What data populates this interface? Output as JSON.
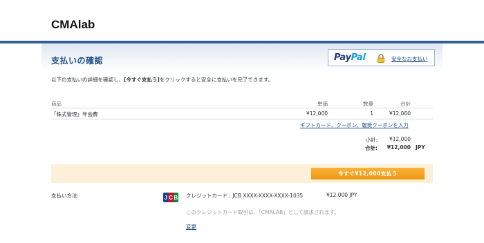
{
  "merchant": {
    "name": "CMAlab"
  },
  "header": {
    "title": "支払いの確認"
  },
  "paypal": {
    "logo_pay": "Pay",
    "logo_pal": "Pal",
    "secure_link": "安全なお支払い"
  },
  "intro": {
    "before": "以下の支払いの詳細を確認し、",
    "action": "[今すぐ支払う]",
    "after": "をクリックすると安全に支払いを完了できます。"
  },
  "table": {
    "headers": {
      "item": "商品",
      "unit_price": "単価",
      "quantity": "数量",
      "total": "合計"
    },
    "rows": [
      {
        "item": "「株式管理」年会費",
        "unit_price": "¥12,000",
        "quantity": "1",
        "total": "¥12,000"
      }
    ],
    "coupon_link": "ギフトカード、クーポン、報奨クーポンを入力"
  },
  "summary": {
    "subtotal_label": "小計:",
    "subtotal_value": "¥12,000",
    "total_label": "合計:",
    "total_value": "¥12,000",
    "currency": "JPY"
  },
  "pay_button": {
    "label": "今すぐ¥12,000支払う"
  },
  "payment_method": {
    "label": "支払い方法:",
    "card_logo": "JCB",
    "card_description": "クレジットカード : JCB XXXX-XXXX-XXXX-1035",
    "amount": "¥12,000 JPY",
    "note": "このクレジットカード取引は、「CMALAB」として請求されます。",
    "change_link": "変更"
  }
}
